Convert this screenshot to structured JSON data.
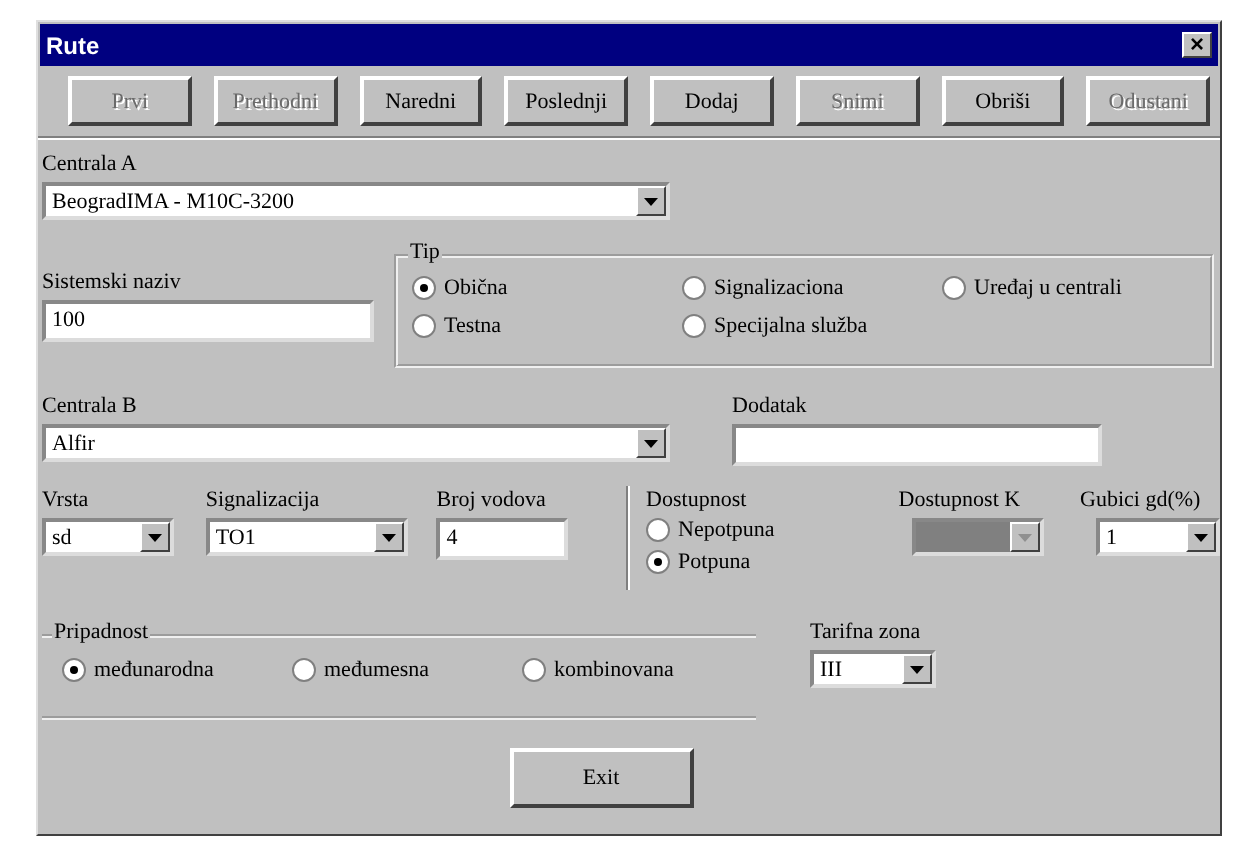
{
  "window": {
    "title": "Rute",
    "close": "×"
  },
  "toolbar": [
    {
      "label": "Prvi",
      "disabled": true
    },
    {
      "label": "Prethodni",
      "disabled": true
    },
    {
      "label": "Naredni",
      "disabled": false
    },
    {
      "label": "Poslednji",
      "disabled": false
    },
    {
      "label": "Dodaj",
      "disabled": false
    },
    {
      "label": "Snimi",
      "disabled": true
    },
    {
      "label": "Obriši",
      "disabled": false
    },
    {
      "label": "Odustani",
      "disabled": true
    }
  ],
  "centrala_a": {
    "label": "Centrala A",
    "value": "BeogradIMA - M10C-3200"
  },
  "sistemski_naziv": {
    "label": "Sistemski naziv",
    "value": "100"
  },
  "tip": {
    "label": "Tip",
    "options": [
      {
        "label": "Obična",
        "selected": true
      },
      {
        "label": "Signalizaciona",
        "selected": false
      },
      {
        "label": "Uređaj u centrali",
        "selected": false
      },
      {
        "label": "Testna",
        "selected": false
      },
      {
        "label": "Specijalna služba",
        "selected": false
      }
    ]
  },
  "centrala_b": {
    "label": "Centrala B",
    "value": "Alfir"
  },
  "dodatak": {
    "label": "Dodatak"
  },
  "vrsta": {
    "label": "Vrsta",
    "value": "sd"
  },
  "signalizacija": {
    "label": "Signalizacija",
    "value": "TO1"
  },
  "broj_vodova": {
    "label": "Broj vodova",
    "value": "4"
  },
  "dostupnost": {
    "label": "Dostupnost",
    "options": [
      {
        "label": "Nepotpuna",
        "selected": false
      },
      {
        "label": "Potpuna",
        "selected": true
      }
    ]
  },
  "dostupnost_k": {
    "label": "Dostupnost K",
    "disabled": true
  },
  "gubici": {
    "label": "Gubici gd(%)",
    "value": "1"
  },
  "pripadnost": {
    "label": "Pripadnost",
    "options": [
      {
        "label": "međunarodna",
        "selected": true
      },
      {
        "label": "međumesna",
        "selected": false
      },
      {
        "label": "kombinovana",
        "selected": false
      }
    ]
  },
  "tarifna_zona": {
    "label": "Tarifna zona",
    "value": "III"
  },
  "exit_button": "Exit"
}
